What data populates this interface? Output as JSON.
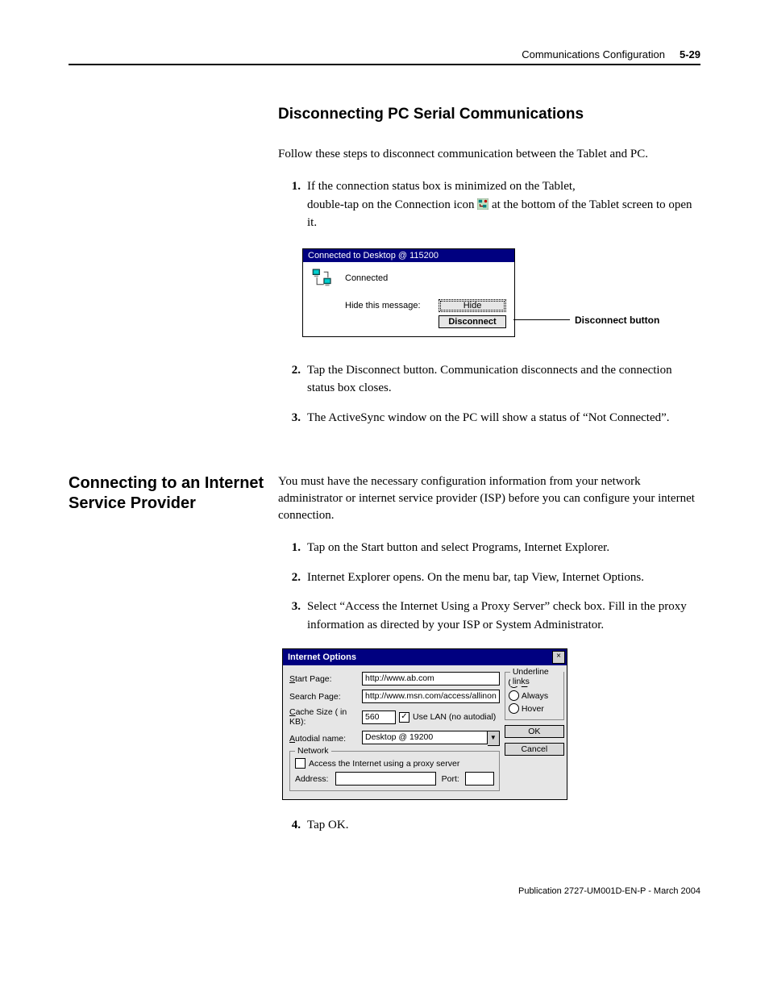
{
  "header": {
    "chapter": "Communications Configuration",
    "page": "5-29"
  },
  "section1": {
    "heading": "Disconnecting PC Serial Communications",
    "intro": "Follow these steps to disconnect communication between the Tablet and PC.",
    "steps": {
      "s1a": "If the connection status box is minimized on the Tablet,",
      "s1b_pre": "double-tap on the Connection icon ",
      "s1b_post": " at the bottom of the Tablet screen to open it.",
      "s2": "Tap the Disconnect button. Communication disconnects and the connection status box closes.",
      "s3": "The ActiveSync window on the PC will show a status of “Not Connected”."
    },
    "shot": {
      "title": "Connected to Desktop @ 115200",
      "status": "Connected",
      "hide_label": "Hide this message:",
      "hide_btn": "Hide",
      "disc_btn": "Disconnect",
      "callout": "Disconnect button"
    }
  },
  "section2": {
    "side_heading": "Connecting to an Internet Service Provider",
    "intro": "You must have the necessary configuration information from your network administrator or internet service provider (ISP) before you can configure your internet connection.",
    "steps": {
      "s1": "Tap on the Start button and select Programs, Internet Explorer.",
      "s2": "Internet Explorer opens. On the menu bar, tap View, Internet Options.",
      "s3": "Select “Access the Internet Using a Proxy Server” check box. Fill in the proxy information as directed by your ISP or System Administrator.",
      "s4": "Tap OK."
    },
    "dlg": {
      "title": "Internet Options",
      "start_page_lbl": "Start Page:",
      "start_page_val": "http://www.ab.com",
      "search_page_lbl": "Search Page:",
      "search_page_val": "http://www.msn.com/access/allinon",
      "cache_lbl": "Cache Size ( in KB):",
      "cache_val": "560",
      "use_lan_lbl": "Use LAN (no autodial)",
      "autodial_lbl": "Autodial name:",
      "autodial_val": "Desktop @ 19200",
      "network_legend": "Network",
      "proxy_lbl": "Access the Internet using a proxy server",
      "address_lbl": "Address:",
      "port_lbl": "Port:",
      "underline_legend": "Underline links",
      "opt_never": "Never",
      "opt_always": "Always",
      "opt_hover": "Hover",
      "ok": "OK",
      "cancel": "Cancel"
    }
  },
  "footer": "Publication 2727-UM001D-EN-P - March 2004"
}
